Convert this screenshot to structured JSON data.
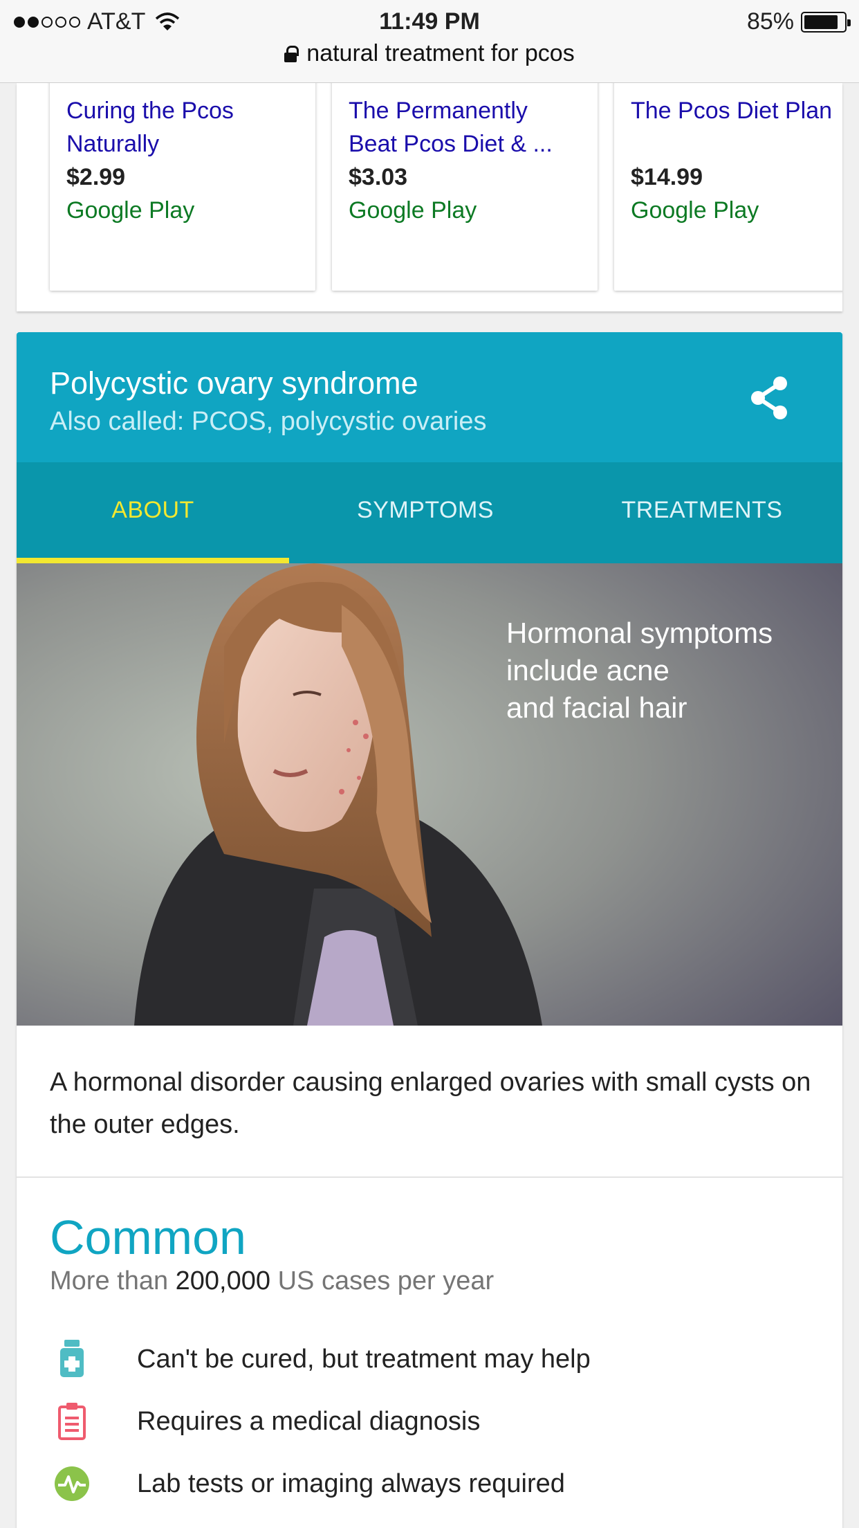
{
  "status_bar": {
    "carrier": "AT&T",
    "time": "11:49 PM",
    "battery": "85%",
    "battery_level": 0.85
  },
  "url_bar": {
    "text": "natural treatment for pcos"
  },
  "books": [
    {
      "title": "Curing the Pcos Naturally",
      "price": "$2.99",
      "store": "Google Play"
    },
    {
      "title": "The Permanently Beat Pcos Diet & ...",
      "price": "$3.03",
      "store": "Google Play"
    },
    {
      "title": "The Pcos Diet Plan",
      "price": "$14.99",
      "store": "Google Play"
    }
  ],
  "knowledge_card": {
    "title": "Polycystic ovary syndrome",
    "also_called": "Also called: PCOS, polycystic ovaries",
    "tabs": [
      "ABOUT",
      "SYMPTOMS",
      "TREATMENTS"
    ],
    "active_tab": "ABOUT",
    "image_caption": "Hormonal symptoms\ninclude acne\nand facial hair",
    "description": "A hormonal disorder causing enlarged ovaries with small cysts on the outer edges.",
    "frequency": "Common",
    "count_prefix": "More than",
    "count_value": "200,000",
    "count_suffix": "US cases per year",
    "facts": [
      {
        "icon": "medicine-bottle-icon",
        "text": "Can't be cured, but treatment may help",
        "color": "#4fbcc4"
      },
      {
        "icon": "clipboard-icon",
        "text": "Requires a medical diagnosis",
        "color": "#ef5b6e"
      },
      {
        "icon": "pulse-icon",
        "text": "Lab tests or imaging always required",
        "color": "#8bc34a"
      }
    ]
  },
  "colors": {
    "header_teal": "#10a5c2",
    "tabs_teal": "#0a96ab",
    "active_tab": "#f3e830",
    "link_blue": "#1a0dab",
    "store_green": "#0d7a24"
  }
}
